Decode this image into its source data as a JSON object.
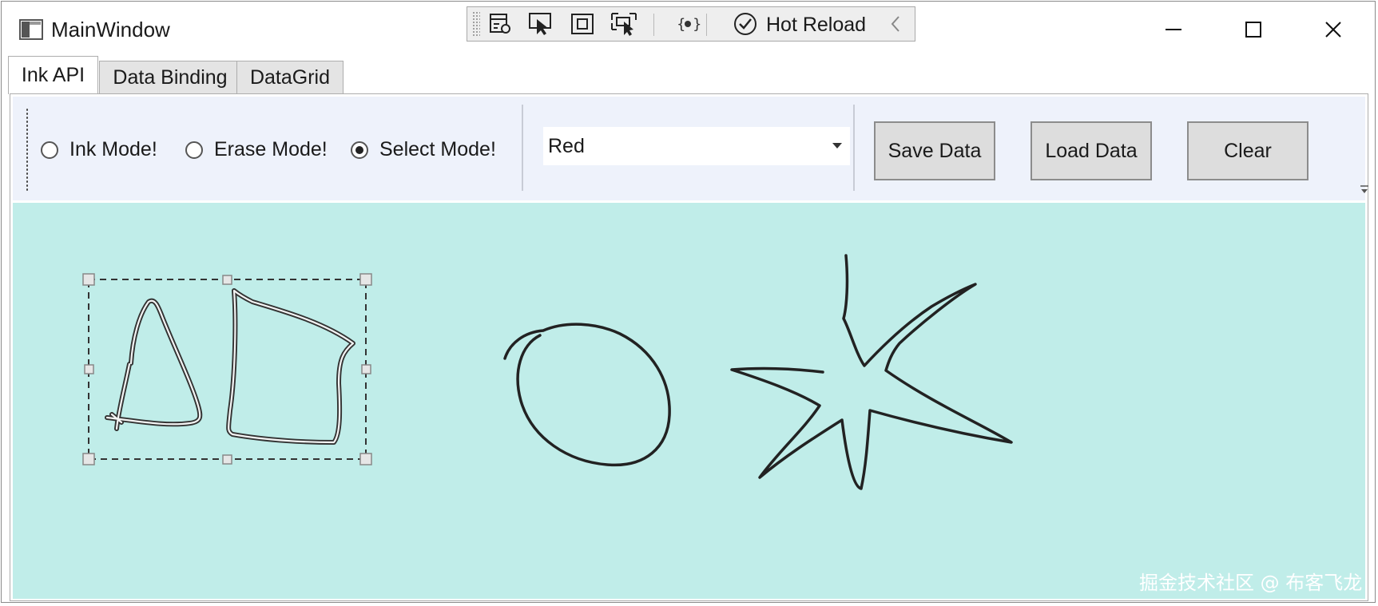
{
  "window": {
    "title": "MainWindow"
  },
  "debug_toolbar": {
    "hot_reload_label": "Hot Reload",
    "tools": [
      "live-visual-tree-icon",
      "select-element-icon",
      "display-layout-adorners-icon",
      "track-focused-element-icon",
      "binding-failures-icon",
      "hot-reload-check-icon",
      "collapse-chevron-icon"
    ]
  },
  "tabs": [
    {
      "label": "Ink API",
      "active": true
    },
    {
      "label": "Data Binding",
      "active": false
    },
    {
      "label": "DataGrid",
      "active": false
    }
  ],
  "toolbar": {
    "modes": [
      {
        "label": "Ink Mode!",
        "checked": false
      },
      {
        "label": "Erase Mode!",
        "checked": false
      },
      {
        "label": "Select Mode!",
        "checked": true
      }
    ],
    "color_combo": {
      "value": "Red"
    },
    "buttons": {
      "save": "Save Data",
      "load": "Load Data",
      "clear": "Clear"
    }
  },
  "canvas": {
    "background": "#c0ede9",
    "stroke_color": "#222222",
    "selected_strokes": [
      "triangle-stroke",
      "quad-stroke"
    ],
    "strokes": [
      "triangle-stroke",
      "quad-stroke",
      "circle-stroke",
      "star-stroke"
    ]
  },
  "watermark": "掘金技术社区 @ 布客飞龙"
}
